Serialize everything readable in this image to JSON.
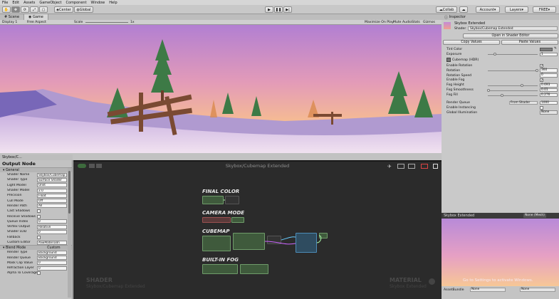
{
  "menu": [
    "File",
    "Edit",
    "Assets",
    "GameObject",
    "Component",
    "Window",
    "Help"
  ],
  "toolbar": {
    "center": "Center",
    "global": "Global",
    "collab": "Collab",
    "account": "Account",
    "layers": "Layers",
    "layout": "FREE"
  },
  "scene_tabs": [
    "Scene",
    "Game"
  ],
  "scene_bar": {
    "display": "Display 1",
    "aspect": "Free Aspect",
    "scale": "Scale",
    "scale_val": "1x",
    "maximize": "Maximize On Play",
    "mute": "Mute Audio",
    "stats": "Stats",
    "gizmos": "Gizmos"
  },
  "output_tab": "Skybox/C...",
  "output": {
    "title": "Output Node",
    "general": "General",
    "rows": [
      {
        "label": "Shader Name",
        "value": "Skybox/Cubemap"
      },
      {
        "label": "Shader Type",
        "value": "Surface Shader"
      },
      {
        "label": "Light Model",
        "value": "Unlit"
      },
      {
        "label": "Shader Model",
        "value": "2.0"
      },
      {
        "label": "Precision",
        "value": "Float"
      },
      {
        "label": "Cull Mode",
        "value": "Off"
      },
      {
        "label": "Render Path",
        "value": "All"
      },
      {
        "label": "Cast Shadows",
        "value": ""
      },
      {
        "label": "Receive Shadows",
        "value": ""
      },
      {
        "label": "Queue Index",
        "value": "0"
      },
      {
        "label": "Vertex Output",
        "value": "Relative"
      },
      {
        "label": "Shader LOD",
        "value": "0"
      },
      {
        "label": "Fallback",
        "value": ""
      },
      {
        "label": "Custom Editor",
        "value": "ASEMaterialIn"
      }
    ],
    "blend": "Blend Mode",
    "blend_val": "Custom",
    "rows2": [
      {
        "label": "Render Type",
        "value": "Background"
      },
      {
        "label": "Render Queue",
        "value": "Background"
      },
      {
        "label": "Mask Clip Value",
        "value": "0"
      },
      {
        "label": "Refraction Layer",
        "value": "0"
      },
      {
        "label": "Alpha To Coverage",
        "value": ""
      }
    ]
  },
  "graph": {
    "title": "Skybox/Cubemap Extended",
    "groups": [
      "FINAL COLOR",
      "CAMERA MODE",
      "CUBEMAP",
      "BUILT-IN FOG"
    ],
    "wm_left": "SHADER",
    "wm_left_sub": "Skybox/Cubemap Extended",
    "wm_right": "MATERIAL",
    "wm_right_sub": "Skybox Extended"
  },
  "inspector": {
    "tab": "Inspector",
    "name": "Skybox Extended",
    "shader_lbl": "Shader",
    "shader_val": "Skybox/Cubemap Extended",
    "open_btn": "Open in Shader Editor",
    "copy_btn": "Copy Values",
    "paste_btn": "Paste Values",
    "tint": "Tint Color",
    "exposure": "Exposure",
    "exposure_val": "1",
    "cubemap": "Cubemap (HDR)",
    "enable_rotation": "Enable Rotation",
    "rotation": "Rotation",
    "rotation_val": "360",
    "rotation_speed": "Rotation Speed",
    "rotation_speed_val": "0",
    "enable_fog": "Enable Fog",
    "fog_height": "Fog Height",
    "fog_height_val": "0.693",
    "fog_smooth": "Fog Smoothness",
    "fog_smooth_val": "0.01",
    "fog_fill": "Fog Fill",
    "fog_fill_val": "0.276",
    "render_queue": "Render Queue",
    "render_queue_sel": "From Shader",
    "render_queue_val": "1000",
    "instancing": "Enable Instancing",
    "gi": "Global Illumination",
    "gi_val": "None",
    "check": "✓"
  },
  "preview": {
    "title": "Skybox Extended",
    "mesh": "None (Mesh)",
    "activate": "Go to Settings to activate Windows.",
    "bundle": "AssetBundle",
    "none1": "None",
    "none2": "None"
  },
  "colors": {
    "graph_bg": "#2b2b2b",
    "node_green": "#3f5a3c",
    "sky_top": "#b57fd0",
    "sky_bottom": "#f7c090"
  }
}
